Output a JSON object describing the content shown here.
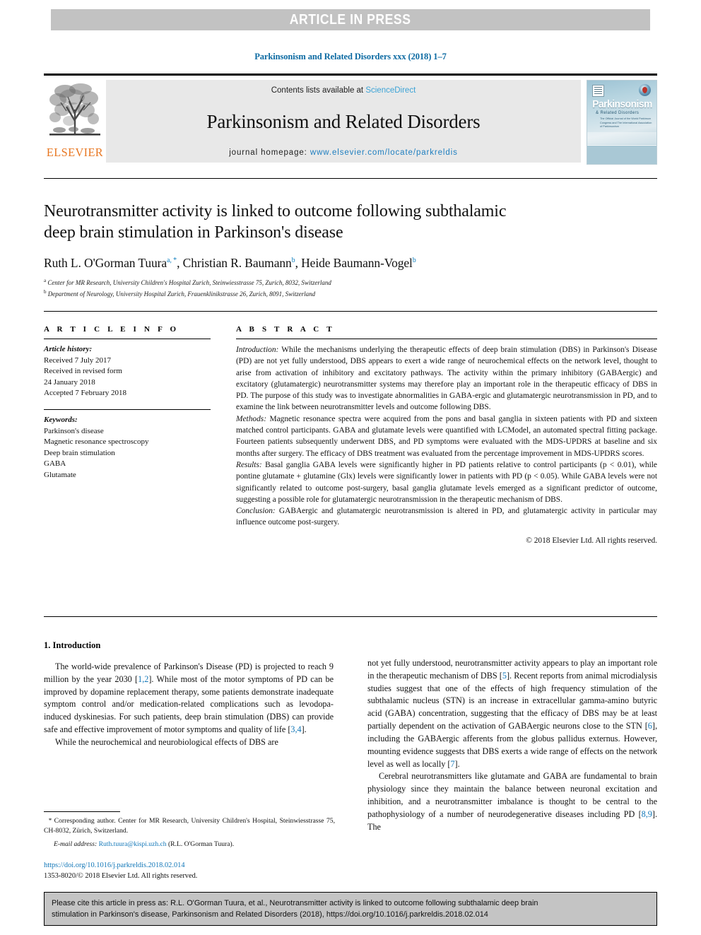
{
  "banner": {
    "text": "ARTICLE IN PRESS"
  },
  "running_head": {
    "text": "Parkinsonism and Related Disorders xxx (2018) 1–7"
  },
  "masthead": {
    "publisher_name": "ELSEVIER",
    "contents_prefix": "Contents lists available at ",
    "contents_link": "ScienceDirect",
    "journal_title": "Parkinsonism and Related Disorders",
    "homepage_label": "journal homepage: ",
    "homepage_url": "www.elsevier.com/locate/parkreldis",
    "cover": {
      "title": "Parkinsonism",
      "subtitle": "& Related Disorders",
      "blurb": "The Official Journal of the World Parkinson Congress\nand The International Association of Parkinsonism"
    }
  },
  "article": {
    "title_line1": "Neurotransmitter activity is linked to outcome following subthalamic",
    "title_line2": "deep brain stimulation in Parkinson's disease",
    "authors": [
      {
        "name": "Ruth L. O'Gorman Tuura",
        "marks": "a, *"
      },
      {
        "name": "Christian R. Baumann",
        "marks": "b"
      },
      {
        "name": "Heide Baumann-Vogel",
        "marks": "b"
      }
    ],
    "affiliations": [
      {
        "mark": "a",
        "text": "Center for MR Research, University Children's Hospital Zurich, Steinwiesstrasse 75, Zurich, 8032, Switzerland"
      },
      {
        "mark": "b",
        "text": "Department of Neurology, University Hospital Zurich, Frauenklinikstrasse 26, Zurich, 8091, Switzerland"
      }
    ]
  },
  "article_info": {
    "heading": "A R T I C L E  I N F O",
    "history_label": "Article history:",
    "history": [
      "Received 7 July 2017",
      "Received in revised form",
      "24 January 2018",
      "Accepted 7 February 2018"
    ],
    "keywords_label": "Keywords:",
    "keywords": [
      "Parkinson's disease",
      "Magnetic resonance spectroscopy",
      "Deep brain stimulation",
      "GABA",
      "Glutamate"
    ]
  },
  "abstract": {
    "heading": "A B S T R A C T",
    "sections": [
      {
        "label": "Introduction:",
        "text": " While the mechanisms underlying the therapeutic effects of deep brain stimulation (DBS) in Parkinson's Disease (PD) are not yet fully understood, DBS appears to exert a wide range of neurochemical effects on the network level, thought to arise from activation of inhibitory and excitatory pathways. The activity within the primary inhibitory (GABAergic) and excitatory (glutamatergic) neurotransmitter systems may therefore play an important role in the therapeutic efficacy of DBS in PD. The purpose of this study was to investigate abnormalities in GABA-ergic and glutamatergic neurotransmission in PD, and to examine the link between neurotransmitter levels and outcome following DBS."
      },
      {
        "label": "Methods:",
        "text": " Magnetic resonance spectra were acquired from the pons and basal ganglia in sixteen patients with PD and sixteen matched control participants. GABA and glutamate levels were quantified with LCModel, an automated spectral fitting package. Fourteen patients subsequently underwent DBS, and PD symptoms were evaluated with the MDS-UPDRS at baseline and six months after surgery. The efficacy of DBS treatment was evaluated from the percentage improvement in MDS-UPDRS scores."
      },
      {
        "label": "Results:",
        "text": " Basal ganglia GABA levels were significantly higher in PD patients relative to control participants (p < 0.01), while pontine glutamate + glutamine (Glx) levels were significantly lower in patients with PD (p < 0.05). While GABA levels were not significantly related to outcome post-surgery, basal ganglia glutamate levels emerged as a significant predictor of outcome, suggesting a possible role for glutamatergic neurotransmission in the therapeutic mechanism of DBS."
      },
      {
        "label": "Conclusion:",
        "text": " GABAergic and glutamatergic neurotransmission is altered in PD, and glutamatergic activity in particular may influence outcome post-surgery."
      }
    ],
    "copyright": "© 2018 Elsevier Ltd. All rights reserved."
  },
  "introduction": {
    "heading": "1. Introduction",
    "left_paragraphs": [
      "The world-wide prevalence of Parkinson's Disease (PD) is projected to reach 9 million by the year 2030 [1,2]. While most of the motor symptoms of PD can be improved by dopamine replacement therapy, some patients demonstrate inadequate symptom control and/or medication-related complications such as levodopa-induced dyskinesias. For such patients, deep brain stimulation (DBS) can provide safe and effective improvement of motor symptoms and quality of life [3,4].",
      "While the neurochemical and neurobiological effects of DBS are"
    ],
    "right_paragraphs": [
      "not yet fully understood, neurotransmitter activity appears to play an important role in the therapeutic mechanism of DBS [5]. Recent reports from animal microdialysis studies suggest that one of the effects of high frequency stimulation of the subthalamic nucleus (STN) is an increase in extracellular gamma-amino butyric acid (GABA) concentration, suggesting that the efficacy of DBS may be at least partially dependent on the activation of GABAergic neurons close to the STN [6], including the GABAergic afferents from the globus pallidus externus. However, mounting evidence suggests that DBS exerts a wide range of effects on the network level as well as locally [7].",
      "Cerebral neurotransmitters like glutamate and GABA are fundamental to brain physiology since they maintain the balance between neuronal excitation and inhibition, and a neurotransmitter imbalance is thought to be central to the pathophysiology of a number of neurodegenerative diseases including PD [8,9]. The"
    ]
  },
  "footnotes": {
    "corresponding": "Corresponding author. Center for MR Research, University Children's Hospital, Steinwiesstrasse 75, CH-8032, Zürich, Switzerland.",
    "email_label": "E-mail address:",
    "email": "Ruth.tuura@kispi.uzh.ch",
    "email_attrib": " (R.L. O'Gorman Tuura).",
    "doi": "https://doi.org/10.1016/j.parkreldis.2018.02.014",
    "issn": "1353-8020/© 2018 Elsevier Ltd. All rights reserved."
  },
  "citation_box": {
    "line1": "Please cite this article in press as: R.L. O'Gorman Tuura, et al., Neurotransmitter activity is linked to outcome following subthalamic deep brain",
    "line2": "stimulation in Parkinson's disease, Parkinsonism and Related Disorders (2018), https://doi.org/10.1016/j.parkreldis.2018.02.014"
  },
  "colors": {
    "banner_bg": "#c2c2c2",
    "link_blue": "#1277b8",
    "running_head_blue": "#0b6aa2",
    "elsevier_orange": "#e87722",
    "masthead_gray": "#e8e8e8",
    "cite_box_gray": "#c4c4c4"
  }
}
